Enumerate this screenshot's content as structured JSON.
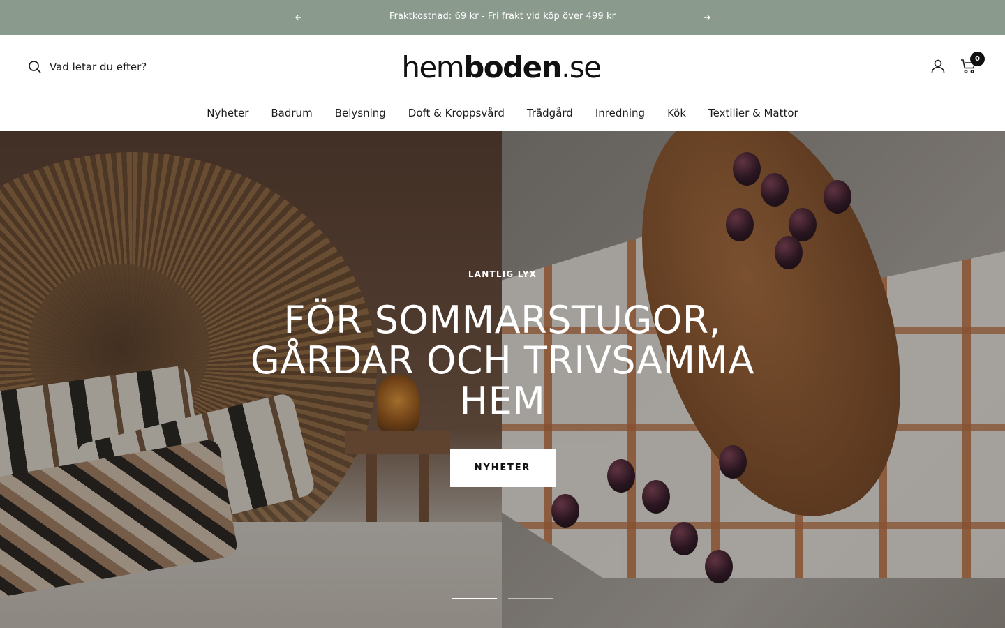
{
  "announcement": {
    "text": "Fraktkostnad: 69 kr - Fri frakt vid köp över 499 kr",
    "prev_icon": "arrow-left-icon",
    "next_icon": "arrow-right-icon"
  },
  "header": {
    "search_placeholder": "Vad letar du efter?",
    "logo": {
      "part1": "hem",
      "part2": "boden",
      "part3": ".se"
    },
    "cart_count": "0",
    "account_icon": "user-icon",
    "cart_icon": "cart-icon"
  },
  "nav": {
    "items": [
      "Nyheter",
      "Badrum",
      "Belysning",
      "Doft & Kroppsvård",
      "Trädgård",
      "Inredning",
      "Kök",
      "Textilier & Mattor"
    ]
  },
  "hero": {
    "eyebrow": "LANTLIG LYX",
    "title": "FÖR SOMMARSTUGOR, GÅRDAR OCH TRIVSAMMA HEM",
    "cta": "NYHETER",
    "active_slide": 1,
    "slide_count": 2
  },
  "colors": {
    "announcement_bg": "#8a9b8e",
    "text": "#1c1b1b",
    "cta_bg": "#ffffff"
  }
}
